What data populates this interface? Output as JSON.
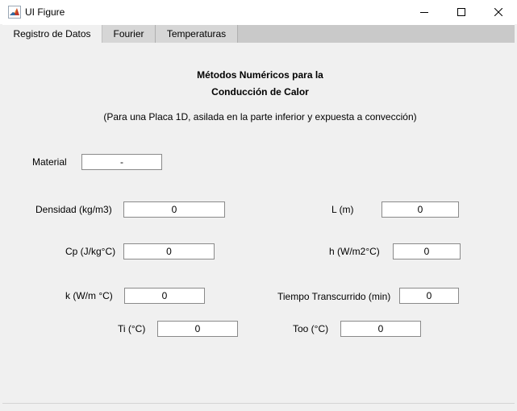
{
  "window": {
    "title": "UI Figure"
  },
  "tabs": [
    {
      "label": "Registro de Datos",
      "active": true
    },
    {
      "label": "Fourier",
      "active": false
    },
    {
      "label": "Temperaturas",
      "active": false
    }
  ],
  "content": {
    "heading_line1": "Métodos Numéricos para la",
    "heading_line2": "Conducción de Calor",
    "subheading": "(Para una Placa 1D, asilada en la parte inferior y expuesta a convección)"
  },
  "fields": {
    "material": {
      "label": "Material",
      "value": "-"
    },
    "densidad": {
      "label": "Densidad (kg/m3)",
      "value": "0"
    },
    "cp": {
      "label": "Cp (J/kg°C)",
      "value": "0"
    },
    "k": {
      "label": "k (W/m °C)",
      "value": "0"
    },
    "ti": {
      "label": "Ti (°C)",
      "value": "0"
    },
    "l": {
      "label": "L (m)",
      "value": "0"
    },
    "h": {
      "label": "h (W/m2°C)",
      "value": "0"
    },
    "tiempo": {
      "label": "Tiempo Transcurrido (min)",
      "value": "0"
    },
    "too": {
      "label": "Too (°C)",
      "value": "0"
    }
  },
  "icons": {
    "app": "matlab-icon",
    "minimize": "minimize-icon",
    "maximize": "maximize-icon",
    "close": "close-icon"
  },
  "colors": {
    "panel_bg": "#f0f0f0",
    "tabbar_bg": "#c9c9c9",
    "active_tab_bg": "#f0f0f0",
    "field_border": "#8a8a8a"
  }
}
